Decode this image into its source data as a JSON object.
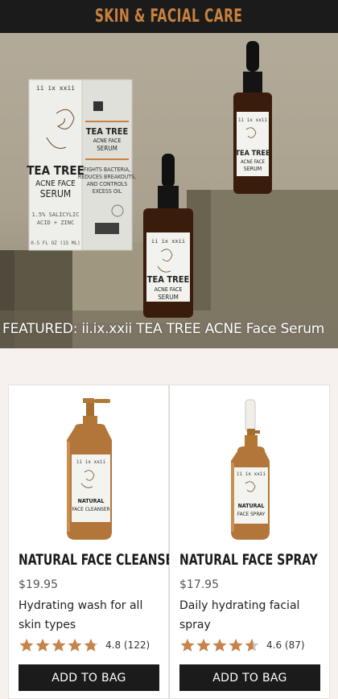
{
  "header": {
    "title": "SKIN & FACIAL CARE"
  },
  "hero": {
    "caption": "FEATURED: ii.ix.xxii TEA TREE ACNE Face Serum",
    "box": {
      "brand": "ii ix xxii",
      "name_line1": "TEA TREE",
      "name_line2": "ACNE FACE",
      "name_line3": "SERUM",
      "ingredient1": "1.5% SALICYLIC",
      "ingredient2": "ACID + ZINC",
      "volume": "0.5 FL OZ (15 ML)",
      "side_name1": "TEA TREE",
      "side_name2": "ACNE FACE",
      "side_name3": "SERUM",
      "side_claim1": "FIGHTS BACTERIA,",
      "side_claim2": "REDUCES BREAKOUTS,",
      "side_claim3": "AND CONTROLS",
      "side_claim4": "EXCESS OIL"
    },
    "bottle_label": {
      "brand": "ii ix xxii",
      "line1": "TEA TREE",
      "line2": "ACNE FACE",
      "line3": "SERUM"
    }
  },
  "products": [
    {
      "name": "NATURAL FACE CLEANSER",
      "price": "$19.95",
      "description": "Hydrating wash for all skin types",
      "rating_text": "4.8 (122)",
      "rating": 4.8,
      "button": "ADD TO BAG",
      "label_brand": "ii ix xxii",
      "label_line1": "NATURAL",
      "label_line2": "FACE CLEANSER"
    },
    {
      "name": "NATURAL FACE SPRAY",
      "price": "$17.95",
      "description": "Daily hydrating facial spray",
      "rating_text": "4.6 (87)",
      "rating": 4.6,
      "button": "ADD TO BAG",
      "label_brand": "ii ix xxii",
      "label_line1": "NATURAL",
      "label_line2": "FACE SPRAY"
    }
  ],
  "colors": {
    "accent": "#c8813f",
    "bar": "#1b1b1b",
    "star": "#c8834a",
    "star_empty": "#cfc6bf"
  }
}
